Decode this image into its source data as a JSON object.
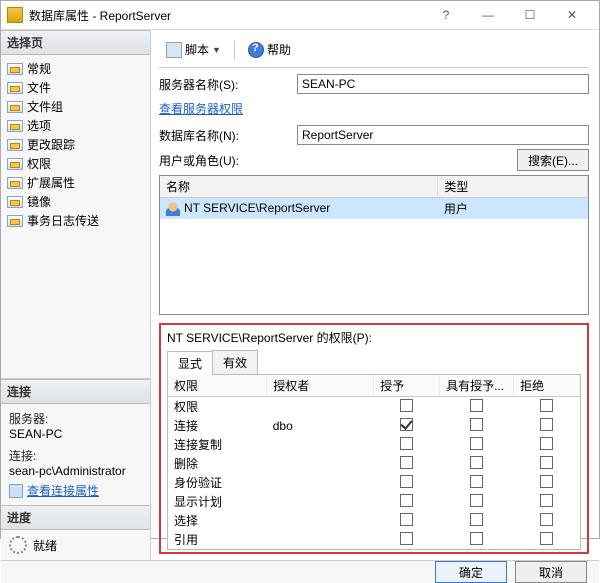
{
  "title": "数据库属性 - ReportServer",
  "titlebar_buttons": {
    "help": "?",
    "min": "—",
    "max": "☐",
    "close": "✕"
  },
  "select_page_header": "选择页",
  "pages": [
    "常规",
    "文件",
    "文件组",
    "选项",
    "更改跟踪",
    "权限",
    "扩展属性",
    "镜像",
    "事务日志传送"
  ],
  "connection_header": "连接",
  "connection": {
    "server_label": "服务器:",
    "server_value": "SEAN-PC",
    "conn_label": "连接:",
    "conn_value": "sean-pc\\Administrator",
    "view_props_link": "查看连接属性"
  },
  "progress_header": "进度",
  "progress_status": "就绪",
  "toolbar": {
    "script_label": "脚本",
    "help_label": "帮助"
  },
  "form": {
    "server_name_label": "服务器名称(S):",
    "server_name_value": "SEAN-PC",
    "view_server_perms_link": "查看服务器权限",
    "db_name_label": "数据库名称(N):",
    "db_name_value": "ReportServer",
    "users_label": "用户或角色(U):",
    "search_button": "搜索(E)..."
  },
  "users_columns": {
    "name": "名称",
    "type": "类型"
  },
  "users_rows": [
    {
      "name": "NT SERVICE\\ReportServer",
      "type": "用户"
    }
  ],
  "perm_title": "NT SERVICE\\ReportServer 的权限(P):",
  "perm_tabs": {
    "explicit": "显式",
    "effective": "有效"
  },
  "perm_columns": {
    "permission": "权限",
    "grantor": "授权者",
    "grant": "授予",
    "with_grant": "具有授予...",
    "deny": "拒绝"
  },
  "perm_rows": [
    {
      "permission": "权限",
      "grantor": "",
      "grant": false,
      "with_grant": false,
      "deny": false
    },
    {
      "permission": "连接",
      "grantor": "dbo",
      "grant": true,
      "with_grant": false,
      "deny": false
    },
    {
      "permission": "连接复制",
      "grantor": "",
      "grant": false,
      "with_grant": false,
      "deny": false
    },
    {
      "permission": "删除",
      "grantor": "",
      "grant": false,
      "with_grant": false,
      "deny": false
    },
    {
      "permission": "身份验证",
      "grantor": "",
      "grant": false,
      "with_grant": false,
      "deny": false
    },
    {
      "permission": "显示计划",
      "grantor": "",
      "grant": false,
      "with_grant": false,
      "deny": false
    },
    {
      "permission": "选择",
      "grantor": "",
      "grant": false,
      "with_grant": false,
      "deny": false
    },
    {
      "permission": "引用",
      "grantor": "",
      "grant": false,
      "with_grant": false,
      "deny": false
    }
  ],
  "footer": {
    "ok": "确定",
    "cancel": "取消"
  }
}
